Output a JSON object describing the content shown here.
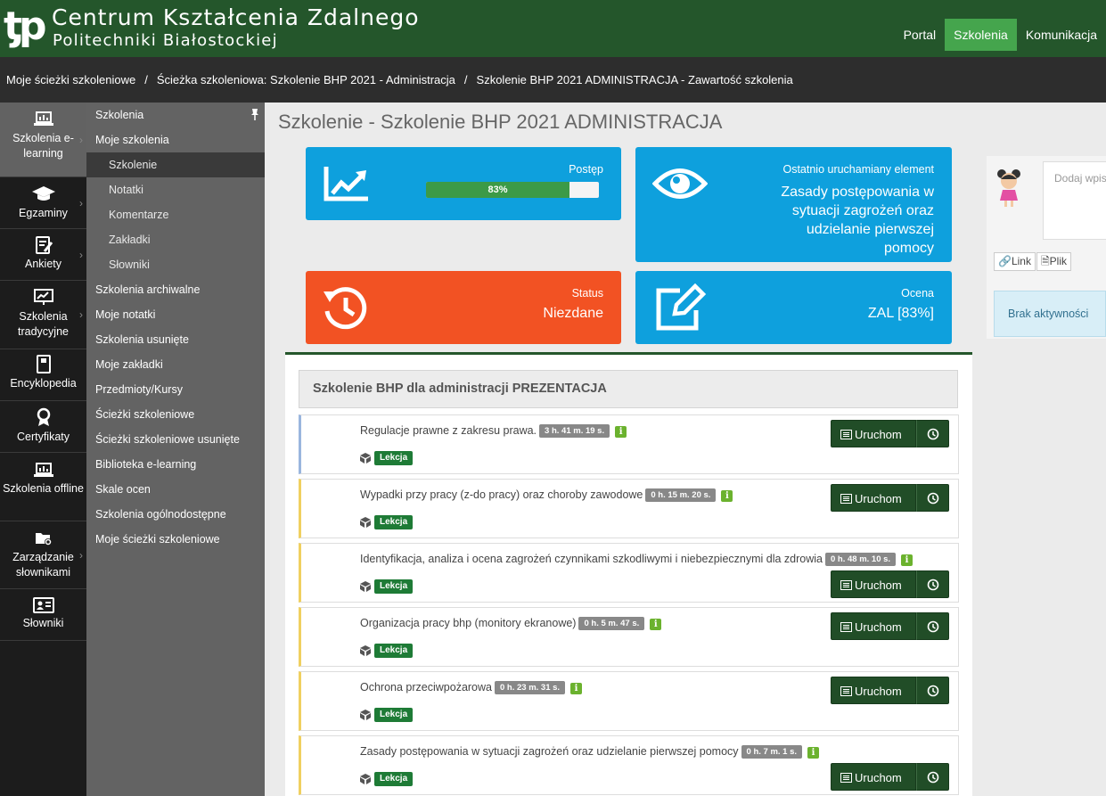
{
  "header": {
    "logo_text": "ƫp",
    "title_line1": "Centrum Kształcenia Zdalnego",
    "title_line2": "Politechniki Białostockiej",
    "nav": [
      "Portal",
      "Szkolenia",
      "Komunikacja"
    ],
    "active_nav": "Szkolenia"
  },
  "breadcrumb": {
    "items": [
      "Moje ścieżki szkoleniowe",
      "Ścieżka szkoleniowa: Szkolenie BHP 2021 - Administracja",
      "Szkolenie BHP 2021 ADMINISTRACJA - Zawartość szkolenia"
    ],
    "separator": "/"
  },
  "sidebar": {
    "items": [
      {
        "label": "Szkolenia e-learning",
        "icon": "laptop-icon"
      },
      {
        "label": "Egzaminy",
        "icon": "graduation-cap-icon"
      },
      {
        "label": "Ankiety",
        "icon": "survey-icon"
      },
      {
        "label": "Szkolenia tradycyjne",
        "icon": "presentation-icon"
      },
      {
        "label": "Encyklopedia",
        "icon": "book-icon"
      },
      {
        "label": "Certyfikaty",
        "icon": "certificate-icon"
      },
      {
        "label": "Szkolenia offline",
        "icon": "laptop-icon"
      },
      {
        "label": "Zarządzanie słownikami",
        "icon": "folder-gear-icon"
      },
      {
        "label": "Słowniki",
        "icon": "id-card-icon"
      }
    ]
  },
  "submenu": {
    "items": [
      "Szkolenia",
      "Moje szkolenia",
      "Szkolenie",
      "Notatki",
      "Komentarze",
      "Zakładki",
      "Słowniki",
      "Szkolenia archiwalne",
      "Moje notatki",
      "Szkolenia usunięte",
      "Moje zakładki",
      "Przedmioty/Kursy",
      "Ścieżki szkoleniowe",
      "Ścieżki szkoleniowe usunięte",
      "Biblioteka e-learning",
      "Skale ocen",
      "Szkolenia ogólnodostępne",
      "Moje ścieżki szkoleniowe"
    ]
  },
  "page": {
    "title": "Szkolenie - Szkolenie BHP 2021 ADMINISTRACJA"
  },
  "cards": {
    "progress": {
      "label": "Postęp",
      "value": 83,
      "text": "83%"
    },
    "last": {
      "label": "Ostatnio uruchamiany element",
      "value": "Zasady postępowania w sytuacji zagrożeń oraz udzielanie pierwszej pomocy"
    },
    "status": {
      "label": "Status",
      "value": "Niezdane"
    },
    "grade": {
      "label": "Ocena",
      "value": "ZAL [83%]"
    }
  },
  "section": {
    "title": "Szkolenie BHP dla administracji PREZENTACJA"
  },
  "lessons": [
    {
      "title": "Regulacje prawne z zakresu prawa.",
      "duration": "3 h. 41 m. 19 s.",
      "tag": "Lekcja"
    },
    {
      "title": "Wypadki przy pracy (z-do pracy) oraz choroby zawodowe",
      "duration": "0 h. 15 m. 20 s.",
      "tag": "Lekcja"
    },
    {
      "title": "Identyfikacja, analiza i ocena zagrożeń czynnikami szkodliwymi i niebezpiecznymi dla zdrowia",
      "duration": "0 h. 48 m. 10 s.",
      "tag": "Lekcja"
    },
    {
      "title": "Organizacja pracy bhp (monitory ekranowe)",
      "duration": "0 h. 5 m. 47 s.",
      "tag": "Lekcja"
    },
    {
      "title": "Ochrona przeciwpożarowa",
      "duration": "0 h. 23 m. 31 s.",
      "tag": "Lekcja"
    },
    {
      "title": "Zasady postępowania w sytuacji zagrożeń oraz udzielanie pierwszej pomocy",
      "duration": "0 h. 7 m. 1 s.",
      "tag": "Lekcja"
    }
  ],
  "lesson_button": {
    "run": "Uruchom",
    "info": "i"
  },
  "comments": {
    "placeholder": "Dodaj wpis",
    "link": "Link",
    "file": "Plik",
    "activity": "Brak aktywności"
  },
  "colors": {
    "header": "#24562b",
    "blue": "#0ea0dd",
    "orange": "#f25223",
    "progress": "#3c9a47",
    "button": "#214d27"
  }
}
